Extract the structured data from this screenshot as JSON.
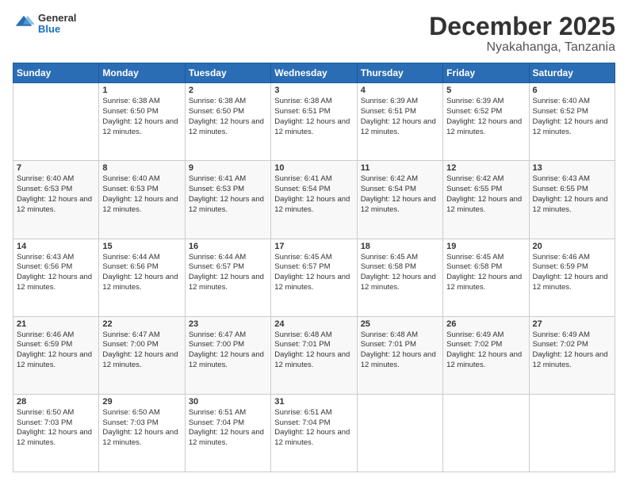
{
  "header": {
    "logo": {
      "general": "General",
      "blue": "Blue"
    },
    "title": "December 2025",
    "location": "Nyakahanga, Tanzania"
  },
  "days_header": [
    "Sunday",
    "Monday",
    "Tuesday",
    "Wednesday",
    "Thursday",
    "Friday",
    "Saturday"
  ],
  "weeks": [
    [
      {
        "day": "",
        "sunrise": "",
        "sunset": "",
        "daylight": ""
      },
      {
        "day": "1",
        "sunrise": "Sunrise: 6:38 AM",
        "sunset": "Sunset: 6:50 PM",
        "daylight": "Daylight: 12 hours and 12 minutes."
      },
      {
        "day": "2",
        "sunrise": "Sunrise: 6:38 AM",
        "sunset": "Sunset: 6:50 PM",
        "daylight": "Daylight: 12 hours and 12 minutes."
      },
      {
        "day": "3",
        "sunrise": "Sunrise: 6:38 AM",
        "sunset": "Sunset: 6:51 PM",
        "daylight": "Daylight: 12 hours and 12 minutes."
      },
      {
        "day": "4",
        "sunrise": "Sunrise: 6:39 AM",
        "sunset": "Sunset: 6:51 PM",
        "daylight": "Daylight: 12 hours and 12 minutes."
      },
      {
        "day": "5",
        "sunrise": "Sunrise: 6:39 AM",
        "sunset": "Sunset: 6:52 PM",
        "daylight": "Daylight: 12 hours and 12 minutes."
      },
      {
        "day": "6",
        "sunrise": "Sunrise: 6:40 AM",
        "sunset": "Sunset: 6:52 PM",
        "daylight": "Daylight: 12 hours and 12 minutes."
      }
    ],
    [
      {
        "day": "7",
        "sunrise": "Sunrise: 6:40 AM",
        "sunset": "Sunset: 6:53 PM",
        "daylight": "Daylight: 12 hours and 12 minutes."
      },
      {
        "day": "8",
        "sunrise": "Sunrise: 6:40 AM",
        "sunset": "Sunset: 6:53 PM",
        "daylight": "Daylight: 12 hours and 12 minutes."
      },
      {
        "day": "9",
        "sunrise": "Sunrise: 6:41 AM",
        "sunset": "Sunset: 6:53 PM",
        "daylight": "Daylight: 12 hours and 12 minutes."
      },
      {
        "day": "10",
        "sunrise": "Sunrise: 6:41 AM",
        "sunset": "Sunset: 6:54 PM",
        "daylight": "Daylight: 12 hours and 12 minutes."
      },
      {
        "day": "11",
        "sunrise": "Sunrise: 6:42 AM",
        "sunset": "Sunset: 6:54 PM",
        "daylight": "Daylight: 12 hours and 12 minutes."
      },
      {
        "day": "12",
        "sunrise": "Sunrise: 6:42 AM",
        "sunset": "Sunset: 6:55 PM",
        "daylight": "Daylight: 12 hours and 12 minutes."
      },
      {
        "day": "13",
        "sunrise": "Sunrise: 6:43 AM",
        "sunset": "Sunset: 6:55 PM",
        "daylight": "Daylight: 12 hours and 12 minutes."
      }
    ],
    [
      {
        "day": "14",
        "sunrise": "Sunrise: 6:43 AM",
        "sunset": "Sunset: 6:56 PM",
        "daylight": "Daylight: 12 hours and 12 minutes."
      },
      {
        "day": "15",
        "sunrise": "Sunrise: 6:44 AM",
        "sunset": "Sunset: 6:56 PM",
        "daylight": "Daylight: 12 hours and 12 minutes."
      },
      {
        "day": "16",
        "sunrise": "Sunrise: 6:44 AM",
        "sunset": "Sunset: 6:57 PM",
        "daylight": "Daylight: 12 hours and 12 minutes."
      },
      {
        "day": "17",
        "sunrise": "Sunrise: 6:45 AM",
        "sunset": "Sunset: 6:57 PM",
        "daylight": "Daylight: 12 hours and 12 minutes."
      },
      {
        "day": "18",
        "sunrise": "Sunrise: 6:45 AM",
        "sunset": "Sunset: 6:58 PM",
        "daylight": "Daylight: 12 hours and 12 minutes."
      },
      {
        "day": "19",
        "sunrise": "Sunrise: 6:45 AM",
        "sunset": "Sunset: 6:58 PM",
        "daylight": "Daylight: 12 hours and 12 minutes."
      },
      {
        "day": "20",
        "sunrise": "Sunrise: 6:46 AM",
        "sunset": "Sunset: 6:59 PM",
        "daylight": "Daylight: 12 hours and 12 minutes."
      }
    ],
    [
      {
        "day": "21",
        "sunrise": "Sunrise: 6:46 AM",
        "sunset": "Sunset: 6:59 PM",
        "daylight": "Daylight: 12 hours and 12 minutes."
      },
      {
        "day": "22",
        "sunrise": "Sunrise: 6:47 AM",
        "sunset": "Sunset: 7:00 PM",
        "daylight": "Daylight: 12 hours and 12 minutes."
      },
      {
        "day": "23",
        "sunrise": "Sunrise: 6:47 AM",
        "sunset": "Sunset: 7:00 PM",
        "daylight": "Daylight: 12 hours and 12 minutes."
      },
      {
        "day": "24",
        "sunrise": "Sunrise: 6:48 AM",
        "sunset": "Sunset: 7:01 PM",
        "daylight": "Daylight: 12 hours and 12 minutes."
      },
      {
        "day": "25",
        "sunrise": "Sunrise: 6:48 AM",
        "sunset": "Sunset: 7:01 PM",
        "daylight": "Daylight: 12 hours and 12 minutes."
      },
      {
        "day": "26",
        "sunrise": "Sunrise: 6:49 AM",
        "sunset": "Sunset: 7:02 PM",
        "daylight": "Daylight: 12 hours and 12 minutes."
      },
      {
        "day": "27",
        "sunrise": "Sunrise: 6:49 AM",
        "sunset": "Sunset: 7:02 PM",
        "daylight": "Daylight: 12 hours and 12 minutes."
      }
    ],
    [
      {
        "day": "28",
        "sunrise": "Sunrise: 6:50 AM",
        "sunset": "Sunset: 7:03 PM",
        "daylight": "Daylight: 12 hours and 12 minutes."
      },
      {
        "day": "29",
        "sunrise": "Sunrise: 6:50 AM",
        "sunset": "Sunset: 7:03 PM",
        "daylight": "Daylight: 12 hours and 12 minutes."
      },
      {
        "day": "30",
        "sunrise": "Sunrise: 6:51 AM",
        "sunset": "Sunset: 7:04 PM",
        "daylight": "Daylight: 12 hours and 12 minutes."
      },
      {
        "day": "31",
        "sunrise": "Sunrise: 6:51 AM",
        "sunset": "Sunset: 7:04 PM",
        "daylight": "Daylight: 12 hours and 12 minutes."
      },
      {
        "day": "",
        "sunrise": "",
        "sunset": "",
        "daylight": ""
      },
      {
        "day": "",
        "sunrise": "",
        "sunset": "",
        "daylight": ""
      },
      {
        "day": "",
        "sunrise": "",
        "sunset": "",
        "daylight": ""
      }
    ]
  ]
}
